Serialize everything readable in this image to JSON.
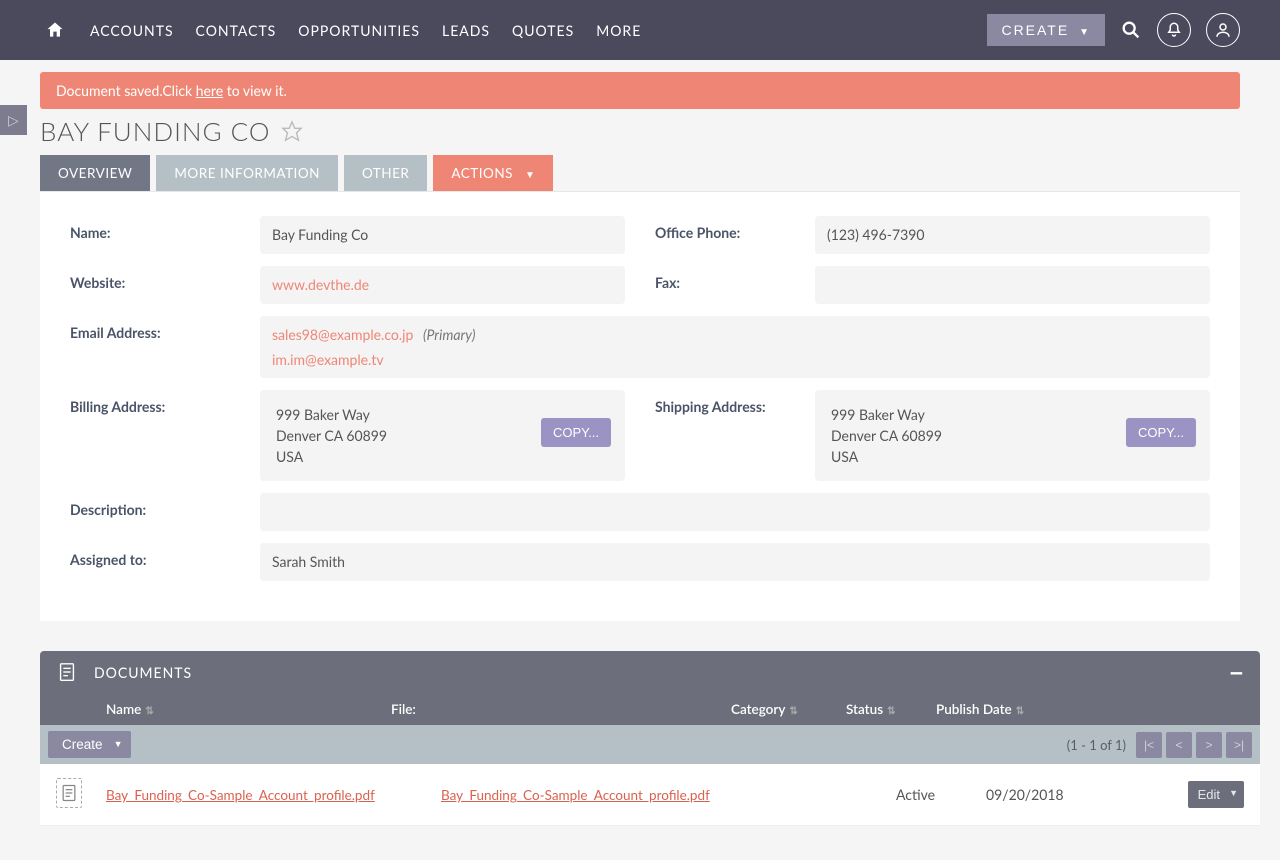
{
  "nav": {
    "items": [
      "ACCOUNTS",
      "CONTACTS",
      "OPPORTUNITIES",
      "LEADS",
      "QUOTES",
      "MORE"
    ],
    "create_label": "CREATE"
  },
  "alert": {
    "prefix": "Document saved.Click ",
    "link": "here",
    "suffix": " to view it."
  },
  "page": {
    "title": "BAY FUNDING CO"
  },
  "tabs": {
    "overview": "OVERVIEW",
    "more_information": "MORE INFORMATION",
    "other": "OTHER",
    "actions": "ACTIONS"
  },
  "fields": {
    "name_label": "Name:",
    "name_value": "Bay Funding Co",
    "office_phone_label": "Office Phone:",
    "office_phone_value": "(123) 496-7390",
    "website_label": "Website:",
    "website_value": "www.devthe.de",
    "fax_label": "Fax:",
    "fax_value": "",
    "email_label": "Email Address:",
    "emails": [
      {
        "addr": "sales98@example.co.jp",
        "tag": "(Primary)"
      },
      {
        "addr": "im.im@example.tv",
        "tag": ""
      }
    ],
    "billing_label": "Billing Address:",
    "billing_addr": {
      "line1": "999 Baker Way",
      "line2": "Denver CA  60899",
      "line3": "USA"
    },
    "shipping_label": "Shipping Address:",
    "shipping_addr": {
      "line1": "999 Baker Way",
      "line2": "Denver CA  60899",
      "line3": "USA"
    },
    "copy_label": "COPY...",
    "description_label": "Description:",
    "description_value": "",
    "assigned_label": "Assigned to:",
    "assigned_value": "Sarah Smith"
  },
  "docs": {
    "panel_title": "DOCUMENTS",
    "cols": {
      "name": "Name",
      "file": "File:",
      "category": "Category",
      "status": "Status",
      "publish_date": "Publish Date"
    },
    "create_label": "Create",
    "pager_text": "(1 - 1 of 1)",
    "pager_first": "|<",
    "pager_prev": "<",
    "pager_next": ">",
    "pager_last": ">|",
    "rows": [
      {
        "name": "Bay_Funding_Co-Sample_Account_profile.pdf",
        "file": "Bay_Funding_Co-Sample_Account_profile.pdf",
        "category": "",
        "status": "Active",
        "publish_date": "09/20/2018"
      }
    ],
    "edit_label": "Edit"
  }
}
